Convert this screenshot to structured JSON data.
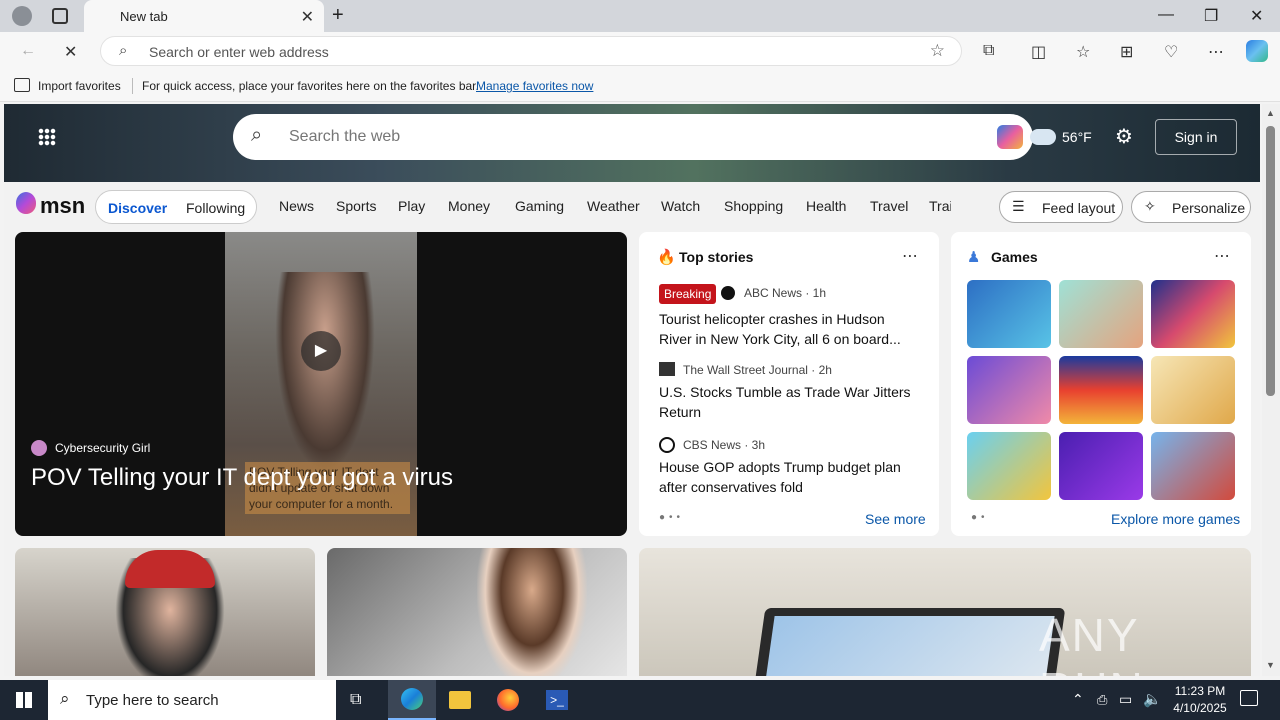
{
  "browser": {
    "tab_title": "New tab",
    "address_placeholder": "Search or enter web address",
    "favorites_import": "Import favorites",
    "favorites_hint": "For quick access, place your favorites here on the favorites bar.",
    "favorites_manage": "Manage favorites now"
  },
  "msn": {
    "search_placeholder": "Search the web",
    "temperature": "56°F",
    "sign_in": "Sign in",
    "logo": "msn",
    "feed_tabs": [
      "Discover",
      "Following"
    ],
    "nav": [
      "News",
      "Sports",
      "Play",
      "Money",
      "Gaming",
      "Weather",
      "Watch",
      "Shopping",
      "Health",
      "Travel",
      "Trai"
    ],
    "feed_layout": "Feed layout",
    "personalize": "Personalize"
  },
  "hero_video": {
    "source": "Cybersecurity Girl",
    "title": "POV Telling your IT dept you got a virus",
    "overlay_text": "POV Telling your IT dept didn't update or shut down your computer for a month."
  },
  "top_stories": {
    "heading": "Top stories",
    "see_more": "See more",
    "items": [
      {
        "badge": "Breaking",
        "source": "ABC News · 1h",
        "title": "Tourist helicopter crashes in Hudson River in New York City, all 6 on board..."
      },
      {
        "source": "The Wall Street Journal · 2h",
        "title": "U.S. Stocks Tumble as Trade War Jitters Return"
      },
      {
        "source": "CBS News · 3h",
        "title": "House GOP adopts Trump budget plan after conservatives fold"
      }
    ]
  },
  "games": {
    "heading": "Games",
    "explore": "Explore more games",
    "tiles": [
      "#3a8fd6",
      "#7fd3c4",
      "#233b9c",
      "#9a6fd8",
      "#1b3fa8",
      "#f0d48a",
      "#f2c53d",
      "#5a2fc8",
      "#6aa8e0"
    ]
  },
  "taskbar": {
    "search_placeholder": "Type here to search",
    "time": "11:23 PM",
    "date": "4/10/2025"
  },
  "watermark": "ANY RUN"
}
